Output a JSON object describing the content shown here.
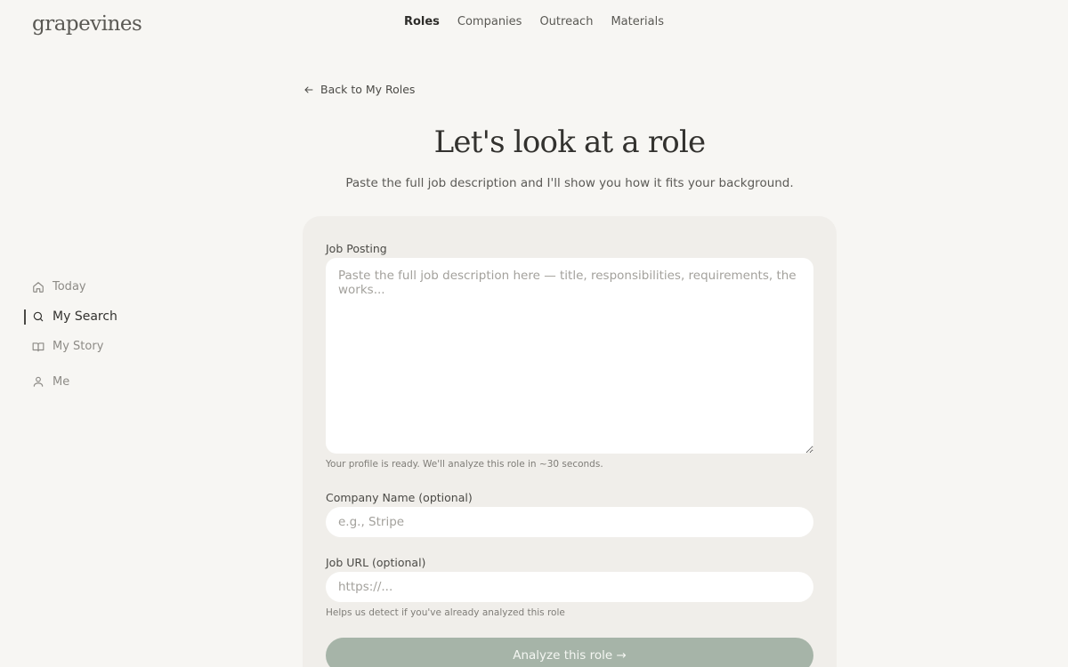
{
  "app": {
    "logo": "grapevines"
  },
  "topnav": [
    {
      "label": "Roles",
      "active": true
    },
    {
      "label": "Companies"
    },
    {
      "label": "Outreach"
    },
    {
      "label": "Materials"
    }
  ],
  "sidebar": {
    "items": [
      {
        "label": "Today",
        "icon": "home-icon"
      },
      {
        "label": "My Search",
        "icon": "search-icon",
        "active": true
      },
      {
        "label": "My Story",
        "icon": "book-icon"
      },
      {
        "label": "Me",
        "icon": "user-icon"
      }
    ]
  },
  "back": {
    "label": "Back to My Roles",
    "icon": "arrow-left-icon"
  },
  "page": {
    "title": "Let's look at a role",
    "subtitle": "Paste the full job description and I'll show you how it fits your background."
  },
  "form": {
    "job_posting": {
      "label": "Job Posting",
      "placeholder": "Paste the full job description here — title, responsibilities, requirements, the works...",
      "value": "",
      "hint": "Your profile is ready. We'll analyze this role in ~30 seconds."
    },
    "company": {
      "label": "Company Name (optional)",
      "placeholder": "e.g., Stripe",
      "value": ""
    },
    "job_url": {
      "label": "Job URL (optional)",
      "placeholder": "https://...",
      "value": "",
      "hint": "Helps us detect if you've already analyzed this role"
    },
    "submit_label": "Analyze this role →"
  },
  "colors": {
    "background": "#f7f6f3",
    "card": "#f0eeea",
    "primary_button": "#a6b4a8",
    "text": "#33322f"
  }
}
